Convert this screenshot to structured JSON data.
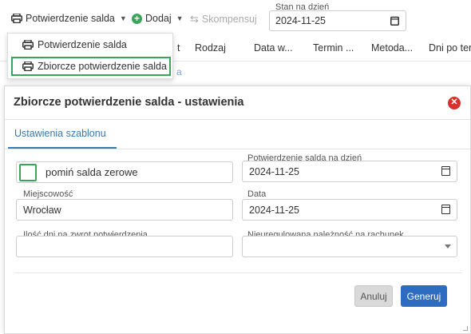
{
  "toolbar": {
    "confirm_label": "Potwierdzenie salda",
    "add_label": "Dodaj",
    "compensate_label": "Skompensuj",
    "stan_label": "Stan na dzień",
    "stan_value": "2024-11-25"
  },
  "grid": {
    "columns": [
      "Rodzaj",
      "Data w...",
      "Termin ...",
      "Metoda...",
      "Dni po ter"
    ],
    "partial_t": "t",
    "row_link": "a"
  },
  "dropdown": {
    "items": [
      "Potwierdzenie salda",
      "Zbiorcze potwierdzenie salda"
    ]
  },
  "modal": {
    "title": "Zbiorcze potwierdzenie salda - ustawienia",
    "tab": "Ustawienia szablonu",
    "skip_zero_label": "pomiń salda zerowe",
    "confirm_date_label": "Potwierdzenie salda na dzień",
    "confirm_date_value": "2024-11-25",
    "city_label": "Miejscowość",
    "city_value": "Wrocław",
    "date_label": "Data",
    "date_value": "2024-11-25",
    "days_label": "Ilość dni na zwrot potwierdzenia",
    "days_value": "",
    "unsettled_label": "Nieuregulowana należność na rachunek",
    "unsettled_value": "",
    "cancel_label": "Anuluj",
    "generate_label": "Generuj"
  },
  "colors": {
    "accent": "#2d6cc0",
    "highlight": "#3aa55a",
    "danger": "#d9322c"
  }
}
